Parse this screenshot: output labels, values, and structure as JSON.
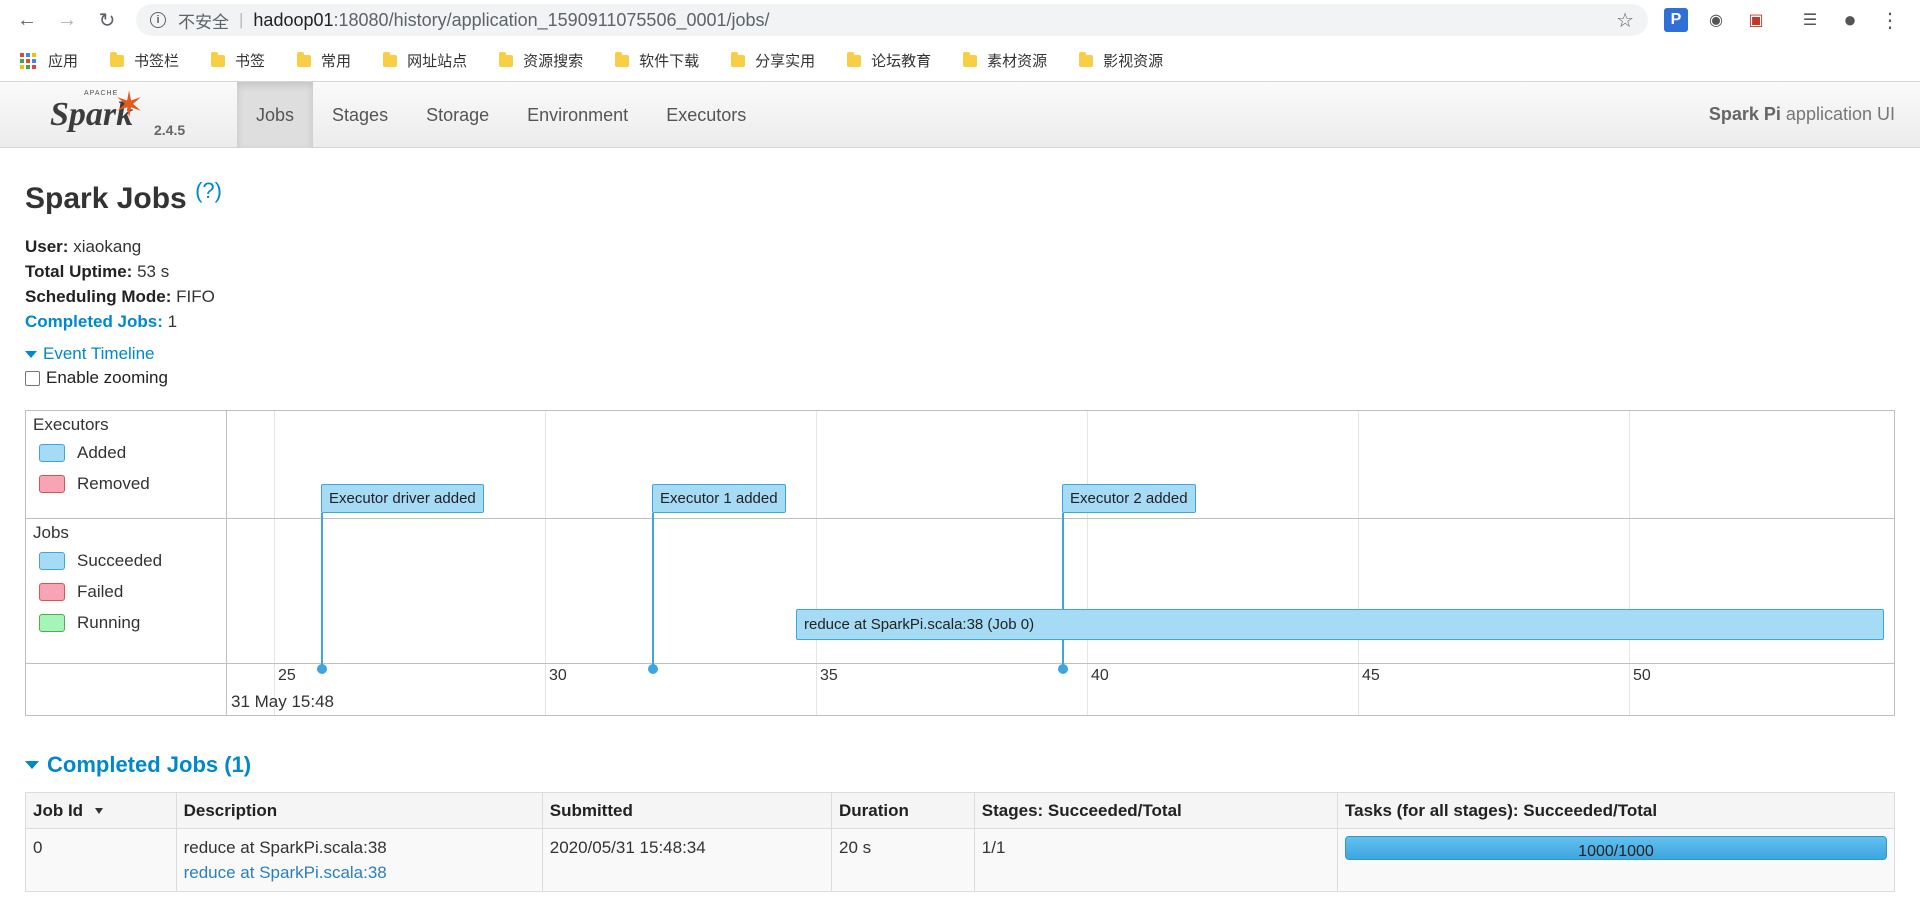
{
  "browser": {
    "insecure_label": "不安全",
    "url_host": "hadoop01",
    "url_path": ":18080/history/application_1590911075506_0001/jobs/"
  },
  "bookmarks": {
    "apps_label": "应用",
    "folders": [
      "书签栏",
      "书签",
      "常用",
      "网址站点",
      "资源搜索",
      "软件下载",
      "分享实用",
      "论坛教育",
      "素材资源",
      "影视资源"
    ]
  },
  "spark_nav": {
    "logo_apache": "APACHE",
    "logo_text": "Spark",
    "version": "2.4.5",
    "tabs": [
      "Jobs",
      "Stages",
      "Storage",
      "Environment",
      "Executors"
    ],
    "active_tab": "Jobs",
    "app_name": "Spark Pi",
    "app_suffix": " application UI"
  },
  "page": {
    "title": "Spark Jobs",
    "help": "(?)",
    "user_label": "User:",
    "user_value": " xiaokang",
    "uptime_label": "Total Uptime:",
    "uptime_value": " 53 s",
    "sched_label": "Scheduling Mode:",
    "sched_value": " FIFO",
    "completed_label": "Completed Jobs:",
    "completed_value": " 1",
    "event_timeline": "Event Timeline",
    "enable_zooming": "Enable zooming"
  },
  "timeline": {
    "executors_group": "Executors",
    "executor_legend": [
      {
        "label": "Added",
        "color": "#a6dbf5"
      },
      {
        "label": "Removed",
        "color": "#f7a4b4"
      }
    ],
    "jobs_group": "Jobs",
    "job_legend": [
      {
        "label": "Succeeded",
        "color": "#a6dbf5"
      },
      {
        "label": "Failed",
        "color": "#f7a4b4"
      },
      {
        "label": "Running",
        "color": "#a6f5b8"
      }
    ],
    "ticks": [
      "25",
      "30",
      "35",
      "40",
      "45",
      "50"
    ],
    "date_label": "31 May 15:48",
    "events": [
      "Executor driver added",
      "Executor 1 added",
      "Executor 2 added"
    ],
    "job_bar": "reduce at SparkPi.scala:38 (Job 0)"
  },
  "completed_jobs": {
    "heading": "Completed Jobs (1)",
    "columns": [
      "Job Id",
      "Description",
      "Submitted",
      "Duration",
      "Stages: Succeeded/Total",
      "Tasks (for all stages): Succeeded/Total"
    ],
    "rows": [
      {
        "job_id": "0",
        "desc_text": "reduce at SparkPi.scala:38",
        "desc_link": "reduce at SparkPi.scala:38",
        "submitted": "2020/05/31 15:48:34",
        "duration": "20 s",
        "stages": "1/1",
        "tasks": "1000/1000",
        "tasks_fraction": 1.0
      }
    ]
  }
}
